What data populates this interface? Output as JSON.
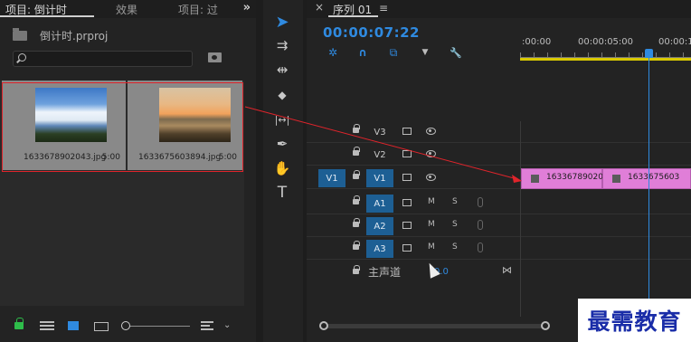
{
  "project": {
    "tabs": [
      {
        "label": "项目: 倒计时"
      },
      {
        "label": "效果"
      },
      {
        "label": "项目: 过"
      }
    ],
    "more_label": "»",
    "file_name": "倒计时.prproj",
    "search": {
      "value": "",
      "placeholder": ""
    },
    "clips": [
      {
        "name": "1633678902043.jpg",
        "duration": "5:00",
        "thumbnail": "sky-clouds"
      },
      {
        "name": "1633675603894.jpg",
        "duration": "5:00",
        "thumbnail": "sunset-lake"
      }
    ],
    "bottom_bar": {
      "sort_chevron": "⌄"
    }
  },
  "tools": {
    "items": [
      {
        "name": "selection-tool-icon",
        "glyph": "➤"
      },
      {
        "name": "track-select-tool-icon",
        "glyph": "⇉"
      },
      {
        "name": "ripple-edit-tool-icon",
        "glyph": "⇹"
      },
      {
        "name": "razor-tool-icon",
        "glyph": "◆"
      },
      {
        "name": "slip-tool-icon",
        "glyph": "|↔|"
      },
      {
        "name": "pen-tool-icon",
        "glyph": "✒"
      },
      {
        "name": "hand-tool-icon",
        "glyph": "✋"
      },
      {
        "name": "type-tool-icon",
        "glyph": "T"
      }
    ]
  },
  "timeline": {
    "close_label": "×",
    "title": "序列 01",
    "menu_label": "≡",
    "timecode": "00:00:07:22",
    "tools": [
      {
        "name": "nest-icon",
        "glyph": "✲"
      },
      {
        "name": "snap-icon",
        "glyph": "∩"
      },
      {
        "name": "linked-selection-icon",
        "glyph": "⧉"
      },
      {
        "name": "add-marker-icon",
        "glyph": "▼"
      },
      {
        "name": "settings-wrench-icon",
        "glyph": "🔧"
      }
    ],
    "ruler": [
      {
        "label": ":00:00"
      },
      {
        "label": "00:00:05:00"
      },
      {
        "label": "00:00:1"
      }
    ],
    "video_tracks": [
      {
        "name": "V3",
        "source": ""
      },
      {
        "name": "V2",
        "source": ""
      },
      {
        "name": "V1",
        "source": "V1"
      }
    ],
    "audio_tracks": [
      {
        "name": "A1",
        "mute": "M",
        "solo": "S"
      },
      {
        "name": "A2",
        "mute": "M",
        "solo": "S"
      },
      {
        "name": "A3",
        "mute": "M",
        "solo": "S"
      }
    ],
    "clips_on_v1": [
      {
        "label": "16336789020"
      },
      {
        "label": "1633675603"
      }
    ],
    "master": {
      "label": "主声道",
      "value": "0.0",
      "bowtie": "⋈"
    }
  },
  "watermark": "最需教育"
}
